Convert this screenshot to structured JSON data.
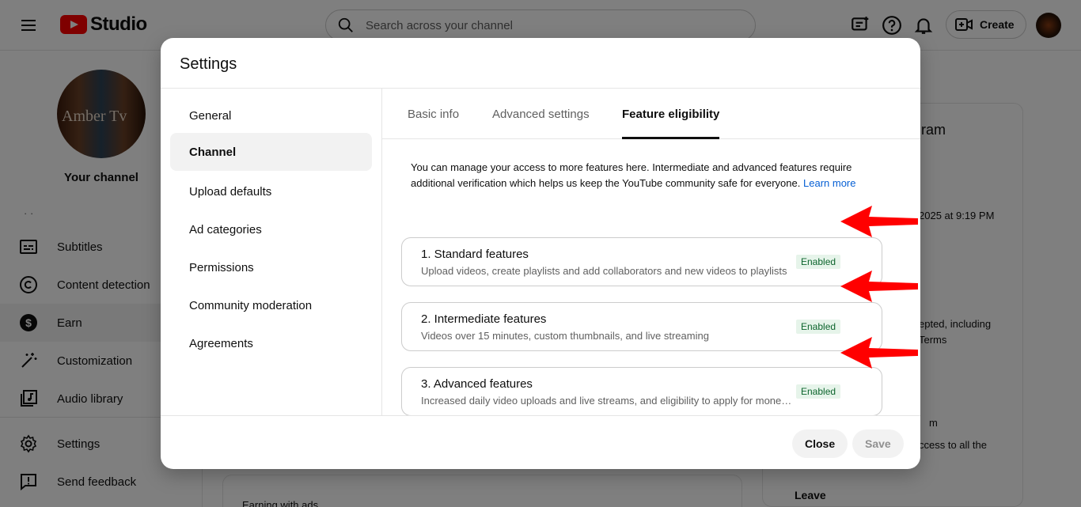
{
  "app": {
    "logo_text": "Studio",
    "search_placeholder": "Search across your channel",
    "create_label": "Create"
  },
  "sidebar": {
    "channel_label": "Your channel",
    "dots": "· ·",
    "items": [
      {
        "label": "Subtitles"
      },
      {
        "label": "Content detection"
      },
      {
        "label": "Earn"
      },
      {
        "label": "Customization"
      },
      {
        "label": "Audio library"
      },
      {
        "label": "Settings"
      },
      {
        "label": "Send feedback"
      }
    ]
  },
  "background": {
    "card_title_fragment": "ram",
    "date_fragment": "2025 at 9:19 PM",
    "text1": "epted, including",
    "text2": "Terms",
    "text3": "m",
    "text4": "ccess to all the",
    "leave_label": "Leave",
    "bottom_text": "Earning with ads"
  },
  "modal": {
    "title": "Settings",
    "menu": [
      {
        "label": "General"
      },
      {
        "label": "Channel"
      },
      {
        "label": "Upload defaults"
      },
      {
        "label": "Ad categories"
      },
      {
        "label": "Permissions"
      },
      {
        "label": "Community moderation"
      },
      {
        "label": "Agreements"
      }
    ],
    "tabs": [
      {
        "label": "Basic info"
      },
      {
        "label": "Advanced settings"
      },
      {
        "label": "Feature eligibility"
      }
    ],
    "intro": "You can manage your access to more features here. Intermediate and advanced features require additional verification which helps us keep the YouTube community safe for everyone.",
    "learn_more": "Learn more",
    "features": [
      {
        "title": "1. Standard features",
        "desc": "Upload videos, create playlists and add collaborators and new videos to playlists",
        "status": "Enabled"
      },
      {
        "title": "2. Intermediate features",
        "desc": "Videos over 15 minutes, custom thumbnails, and live streaming",
        "status": "Enabled"
      },
      {
        "title": "3. Advanced features",
        "desc": "Increased daily video uploads and live streams, and eligibility to apply for monetization",
        "status": "Enabled"
      }
    ],
    "close_label": "Close",
    "save_label": "Save"
  },
  "colors": {
    "brand_red": "#ff0000",
    "badge_bg": "#e6f4ea",
    "badge_text": "#0d652d",
    "link": "#065fd4",
    "annotation_arrow": "#ff0000"
  },
  "icons": [
    "menu-icon",
    "search-icon",
    "feedback-icon",
    "help-icon",
    "bell-icon",
    "video-add-icon",
    "subtitles-icon",
    "copyright-icon",
    "dollar-icon",
    "magic-wand-icon",
    "audio-library-icon",
    "gear-icon",
    "feedback-icon"
  ]
}
